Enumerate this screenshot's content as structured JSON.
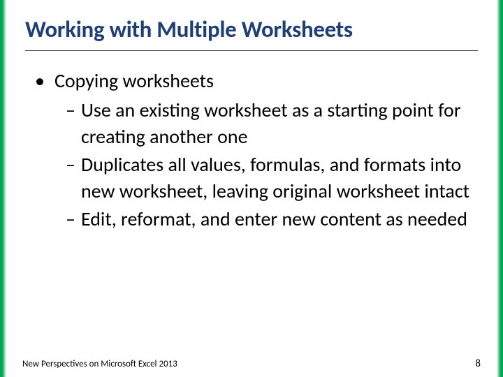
{
  "title": "Working with Multiple Worksheets",
  "bullet": {
    "heading": "Copying worksheets",
    "items": [
      "Use an existing worksheet as a starting point for creating another one",
      "Duplicates all values, formulas, and formats into new worksheet, leaving original worksheet intact",
      "Edit, reformat, and enter new content as needed"
    ]
  },
  "footer": {
    "book": "New Perspectives on Microsoft Excel 2013",
    "page": "8"
  }
}
